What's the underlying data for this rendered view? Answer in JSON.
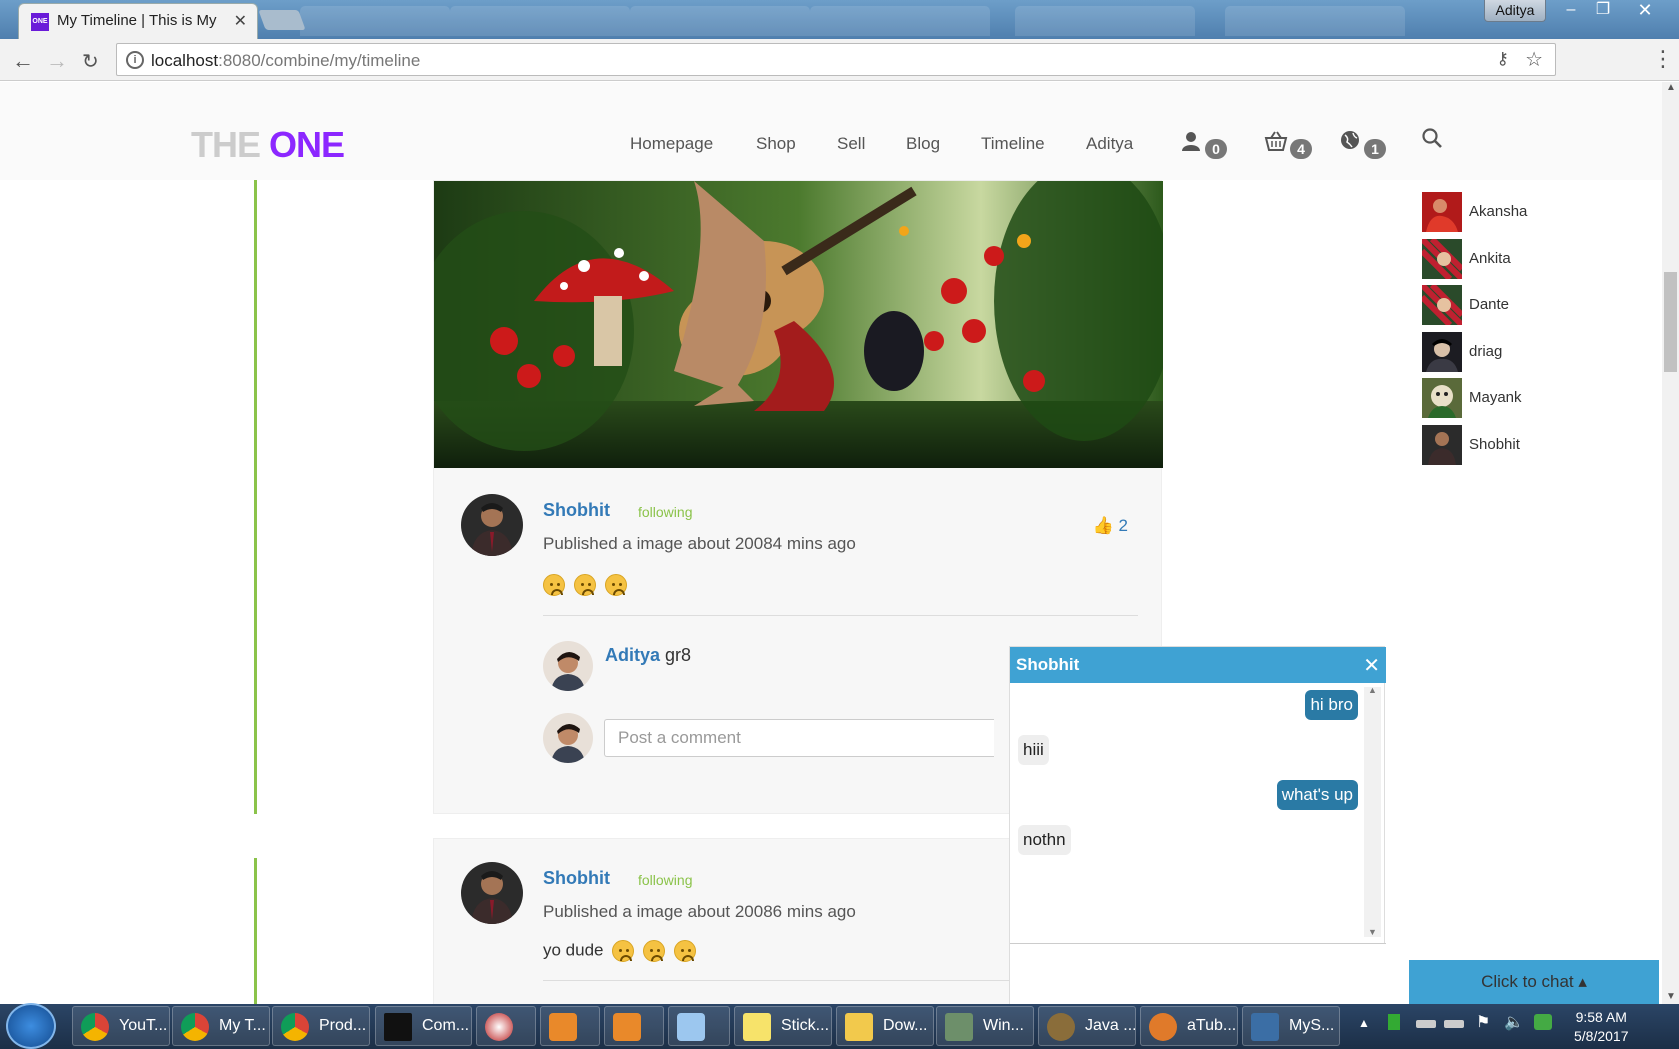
{
  "browser": {
    "tab_title": "My Timeline | This is My",
    "tab_favicon": "ONE",
    "url_host": "localhost",
    "url_rest": ":8080/combine/my/timeline",
    "user": "Aditya"
  },
  "header": {
    "logo_the": "THE",
    "logo_one": "ONE",
    "nav": [
      "Homepage",
      "Shop",
      "Sell",
      "Blog",
      "Timeline",
      "Aditya"
    ],
    "badges": {
      "friends": "0",
      "cart": "4",
      "notifications": "1"
    }
  },
  "post1": {
    "author": "Shobhit",
    "follow_status": "following",
    "meta": "Published a image about 20084 mins ago",
    "likes": "2",
    "comment": {
      "author": "Aditya",
      "text": "gr8"
    },
    "comment_placeholder": "Post a comment"
  },
  "post2": {
    "author": "Shobhit",
    "follow_status": "following",
    "meta": "Published a image about 20086 mins ago",
    "text": "yo dude"
  },
  "contacts": [
    "Akansha",
    "Ankita",
    "Dante",
    "driag",
    "Mayank",
    "Shobhit"
  ],
  "chat": {
    "title": "Shobhit",
    "messages": [
      {
        "from": "me",
        "text": "hi bro"
      },
      {
        "from": "them",
        "text": "hiii"
      },
      {
        "from": "me",
        "text": "what's up"
      },
      {
        "from": "them",
        "text": "nothn"
      }
    ],
    "toggle_label": "Click to chat"
  },
  "taskbar": {
    "items": [
      "YouT...",
      "My T...",
      "Prod...",
      "Com...",
      "",
      "",
      "",
      "",
      "Stick...",
      "Dow...",
      "Win...",
      "Java ...",
      "aTub...",
      "MyS..."
    ],
    "time": "9:58 AM",
    "date": "5/8/2017"
  },
  "colors": {
    "accent": "#3fa2d3",
    "brand": "#8c27ff",
    "timeline_line": "#8bc34a",
    "link": "#337ab7"
  }
}
